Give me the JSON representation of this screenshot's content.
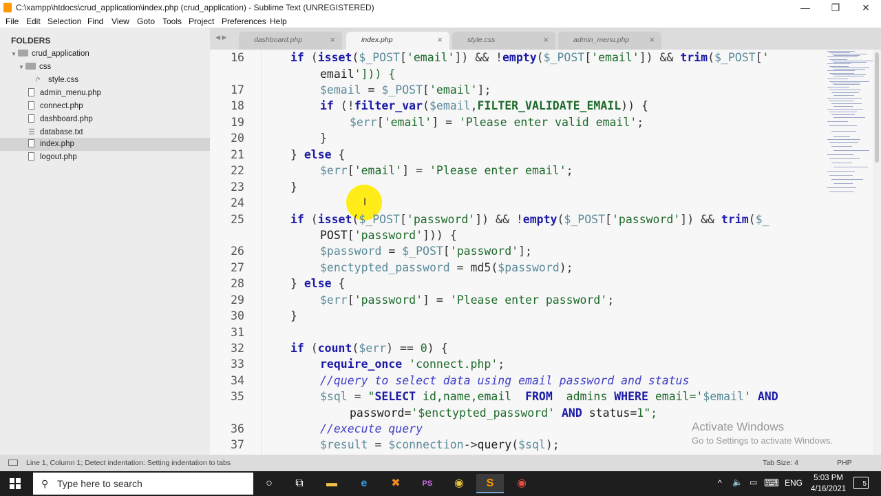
{
  "window": {
    "title": "C:\\xampp\\htdocs\\crud_application\\index.php (crud_application) - Sublime Text (UNREGISTERED)",
    "minimize": "—",
    "restore": "❐",
    "close": "✕"
  },
  "menu": [
    "File",
    "Edit",
    "Selection",
    "Find",
    "View",
    "Goto",
    "Tools",
    "Project",
    "Preferences",
    "Help"
  ],
  "sidebar": {
    "header": "FOLDERS",
    "items": [
      {
        "label": "crud_application",
        "kind": "folder"
      },
      {
        "label": "css",
        "kind": "folder"
      },
      {
        "label": "style.css",
        "kind": "file"
      },
      {
        "label": "admin_menu.php",
        "kind": "file"
      },
      {
        "label": "connect.php",
        "kind": "file"
      },
      {
        "label": "dashboard.php",
        "kind": "file"
      },
      {
        "label": "database.txt",
        "kind": "file"
      },
      {
        "label": "index.php",
        "kind": "file",
        "selected": true
      },
      {
        "label": "logout.php",
        "kind": "file"
      }
    ]
  },
  "tabs": {
    "nav": "◀ ▶",
    "items": [
      {
        "label": "dashboard.php",
        "close": "×"
      },
      {
        "label": "index.php",
        "close": "×",
        "active": true
      },
      {
        "label": "style.css",
        "close": "×"
      },
      {
        "label": "admin_menu.php",
        "close": "×"
      }
    ]
  },
  "editor": {
    "line_numbers": [
      "16",
      "17",
      "18",
      "19",
      "20",
      "21",
      "22",
      "23",
      "24",
      "25",
      "26",
      "27",
      "28",
      "29",
      "30",
      "31",
      "32",
      "33",
      "34",
      "35",
      "36",
      "37"
    ],
    "text": {
      "l16a": "if (isset($_POST['email']) && !empty($_POST['email']) && trim($_POST['",
      "l16b": "email'])) {",
      "l17": "$email = $_POST['email'];",
      "l18": "if (!filter_var($email,FILTER_VALIDATE_EMAIL)) {",
      "l19": "$err['email'] = 'Please enter valid email';",
      "l20": "}",
      "l21": "} else {",
      "l22": "$err['email'] = 'Please enter email';",
      "l23": "}",
      "l25a": "if (isset($_POST['password']) && !empty($_POST['password']) && trim($_",
      "l25b": "POST['password'])) {",
      "l26": "$password = $_POST['password'];",
      "l27": "$enctypted_password = md5($password);",
      "l28": "} else {",
      "l29": "$err['password'] = 'Please enter password';",
      "l30": "}",
      "l32": "if (count($err) == 0) {",
      "l33": "require_once 'connect.php';",
      "l34": "//query to select data using email password and status",
      "l35a": "$sql = \"SELECT id,name,email  FROM  admins WHERE email='$email' AND",
      "l35b": "password='$enctypted_password' AND status=1\";",
      "l36": "//execute query",
      "l37": "$result = $connection->query($sql);"
    },
    "cursor": "I"
  },
  "watermark": {
    "line1": "Activate Windows",
    "line2": "Go to Settings to activate Windows."
  },
  "status": {
    "message": "Line 1, Column 1; Detect indentation: Setting indentation to tabs",
    "tab_size": "Tab Size: 4",
    "syntax": "PHP"
  },
  "taskbar": {
    "search_placeholder": "Type here to search",
    "search_icon": "⚲",
    "apps": [
      {
        "name": "cortana",
        "glyph": "○"
      },
      {
        "name": "task-view",
        "glyph": "⧉"
      },
      {
        "name": "file-explorer",
        "glyph": "▬"
      },
      {
        "name": "edge",
        "glyph": "e"
      },
      {
        "name": "xampp",
        "glyph": "✖"
      },
      {
        "name": "phpstorm",
        "glyph": "PS"
      },
      {
        "name": "chrome",
        "glyph": "◉"
      },
      {
        "name": "sublime",
        "glyph": "S"
      },
      {
        "name": "chrome-profile",
        "glyph": "◉"
      }
    ],
    "tray": {
      "chevron": "^",
      "volume": "🔈",
      "network": "▭",
      "keyboard": "⌨",
      "lang": "ENG",
      "time": "5:03 PM",
      "date": "4/16/2021",
      "notifications": "5"
    }
  },
  "colors": {
    "keyword": "#1a1aa6",
    "variable": "#5a8a9a",
    "string": "#1d6a2a",
    "comment": "#3f3fc8",
    "cursor_highlight": "#ffea00"
  }
}
